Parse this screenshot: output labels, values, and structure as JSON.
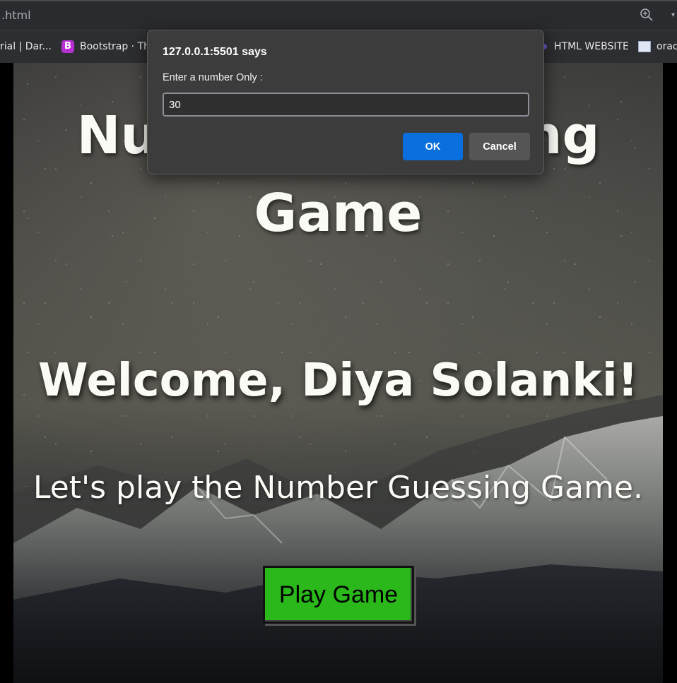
{
  "browser": {
    "address_text": ".html",
    "zoom_icon": "zoom-in-icon",
    "bookmarks": [
      {
        "label": "rial | Dar...",
        "icon": "none"
      },
      {
        "label": "Bootstrap · The",
        "icon": "bootstrap-icon",
        "icon_letter": "B"
      },
      {
        "label": "HTML WEBSITE",
        "icon": "dot-icon"
      },
      {
        "label": "orac",
        "icon": "page-icon"
      }
    ]
  },
  "page": {
    "title": "Number Guessing Game",
    "welcome": "Welcome, Diya Solanki!",
    "subtitle": "Let's play the Number Guessing Game.",
    "play_button": "Play Game",
    "play_button_color": "#2ab81b"
  },
  "dialog": {
    "origin": "127.0.0.1:5501 says",
    "message": "Enter a number Only :",
    "input_value": "30",
    "ok_label": "OK",
    "cancel_label": "Cancel",
    "ok_color": "#0a6fdd"
  }
}
